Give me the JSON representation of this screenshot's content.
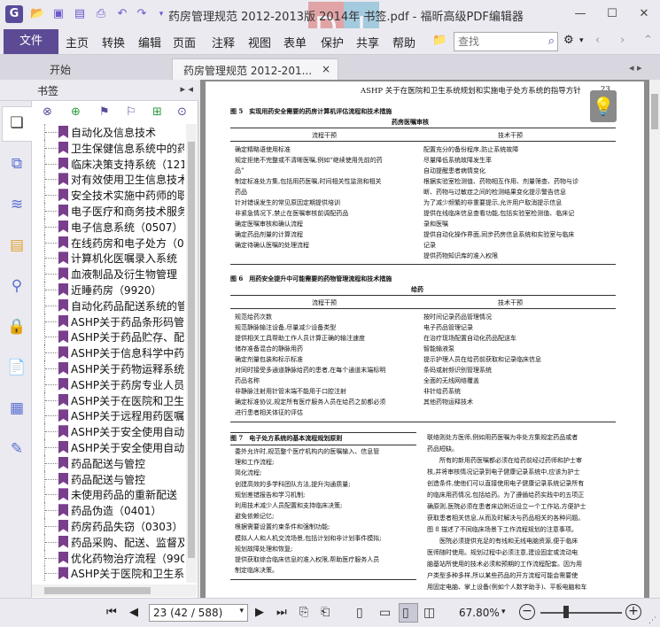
{
  "window": {
    "title": "药房管理规范 2012-2013版 2014年 书签.pdf - 福昕高级PDF编辑器",
    "minimize": "—",
    "maximize": "☐",
    "close": "✕"
  },
  "quick_access": [
    "save-icon",
    "open-icon",
    "print-icon",
    "undo-icon",
    "redo-icon"
  ],
  "menu": {
    "file": "文件",
    "items": [
      "主页",
      "转换",
      "编辑",
      "页面",
      "注释",
      "视图",
      "表单",
      "保护",
      "共享",
      "帮助"
    ],
    "search_placeholder": "查找"
  },
  "tabs": {
    "start": "开始",
    "doc": "药房管理规范 2012-201...",
    "close": "×"
  },
  "sidebar": {
    "title": "书签",
    "bookmarks": [
      "自动化及信息技术",
      "卫生保健信息系统中的药",
      "临床决策支持系统（1212",
      "对有效使用卫生信息技术",
      "安全技术实施中药师的职",
      "电子医疗和商务技术服务",
      "电子信息系统（0507）",
      "在线药房和电子处方（0",
      "计算机化医嘱录入系统（",
      "血液制品及衍生物管理（",
      "近睡药房（9920）",
      "自动化药品配送系统的管",
      "ASHP关于药品条形码管",
      "ASHP关于药品贮存、配",
      "ASHP关于信息科学中药",
      "ASHP关于药物运释系统",
      "ASHP关于药房专业人员",
      "ASHP关于在医院和卫生",
      "ASHP关于远程用药医嘱",
      "ASHP关于安全使用自动",
      "ASHP关于安全使用自动",
      "药品配送与管控",
      "药品配送与管控",
      "未使用药品的重新配送（",
      "药品伪造（0401）",
      "药房药品失窃（0303）",
      "药品采购、配送、监督及",
      "优化药物治疗流程（990",
      "ASHP关于医院和卫生系"
    ]
  },
  "page": {
    "header": "ASHP 关于在医院和卫生系统规划和实施电子处方系统的指导方针",
    "number": "23",
    "fig5": {
      "title": "图 5　实现用药安全需要的药房计算机评估流程和技术措施",
      "subtitle": "药房医嘱审核",
      "col1": "流程干预",
      "col2": "技术干预",
      "left": [
        "确定精略语使用标准",
        "规定拒绝不完整或不清晰医嘱,例如“继续使用先前的药",
        "品”",
        "制定标准处方集,包括用药医嘱,时间相关性监测和相关",
        "药品",
        "针对错误发生的常见原因定期提供培训",
        "非紧急情况下,禁止在医嘱审核前调配药品",
        "确定医嘱审核和确认流程",
        "确定药品剂量的计算流程",
        "确定待确认医嘱的处理流程"
      ],
      "right": [
        "配置充分的备份程序,防止系统故障",
        "尽量降低系统故障发生率",
        "自动提醒患者病情变化",
        "根据实验室检测值、药物相互作用、剂量筛查、药物与诊",
        "断、药物与过敏症之间的检测结果变化提示警告信息",
        "为了减少频繁的非重要提示,允许用户取消提示信息",
        "提供在线临床信息查看功能,包括实验室检测值、临床记",
        "录和医嘱",
        "提供自动化操作界面,同步药房信息系统和实验室与临床",
        "记录",
        "提供药物知识库的准入权限"
      ]
    },
    "fig6": {
      "title": "图 6　用药安全提升中可能需要的药物管理流程和技术措施",
      "subtitle": "给药",
      "col1": "流程干预",
      "col2": "技术干预",
      "left": [
        "规范给药次数",
        "规范静脉输注设备,尽量减少设备类型",
        "提供相关工具帮助工作人员计算正确的输注速度",
        "储存准备混合的静脉用药",
        "确定剂量包装和标示标准",
        "对同时接受多通道静脉给药的患者,在每个通道末端标明",
        "药品名称",
        "非静脉注射用针管末端不能用于口腔注射",
        "确定标准协议,规定所有医疗服务人员在给药之前都必须",
        "进行患者相关体征的评估"
      ],
      "right": [
        "按时间记录药品管理情况",
        "电子药品管理记录",
        "在治疗现场配置自动化药品配送车",
        "智能输液泵",
        "提示护理人员在给药前获取和记录临床信息",
        "条码或射频识别管理系统",
        "全面的无线网络覆盖",
        "非针给药系统",
        "其他药物运释技术"
      ]
    },
    "fig7": {
      "title": "图 7　电子处方系统的基本流程规划原则",
      "left": [
        "委外允许时,规范整个医疗机构内的医嘱输入、信息管",
        "理和工作流程;",
        "简化流程;",
        "创建高效的多学科团队方法,提升沟通质量;",
        "规划差错报告和学习机制;",
        "利用技术减少人员配置和支持临床决策;",
        "避免依赖记忆;",
        "根据需要设置约束条件和强制功能;",
        "模拟人人和人机交流场景,包括计划和非计划事件模拟;",
        "规划故障处理和恢复;",
        "提供获取综合临床信息的准入权限,帮助医疗服务人员",
        "制定临床决策。"
      ],
      "right": [
        "联络则处方医师,例如用药医嘱为非处方集规定药品或者",
        "药品短缺。",
        "　　所有的新用药医嘱都必须在给药前经过药师和护士审",
        "核,并将审核情况记录到电子健康记录系统中,应该为护士",
        "创造条件,使他们可以直接使用电子健康记录系统记录所有",
        "的临床用药情况,包括给药。为了遵循给药实践中的五项正",
        "确原则,医院必须在患者床边附近设立一个工作站,方便护士",
        "获取患者相关信息,从而及时解决与药品相关的各种问题。",
        "图 8 描述了不同临床场景下工作流程规划的注意事项。",
        "　　医院必须提供充足的有线和无线电脑资源,便于临床",
        "医师随时使用。规划过程中必须注意,建设固定或流动电",
        "脑基站所使用的技术必须和预期的工作流程配套。因为用",
        "户类型多种多样,所以某些药品的开方流程可能会需要使",
        "用固定电脑、掌上设备(例如个人数字助手)、平板电脑和车"
      ]
    }
  },
  "status": {
    "page_field": "23 (42 / 588)",
    "zoom": "67.80%"
  }
}
